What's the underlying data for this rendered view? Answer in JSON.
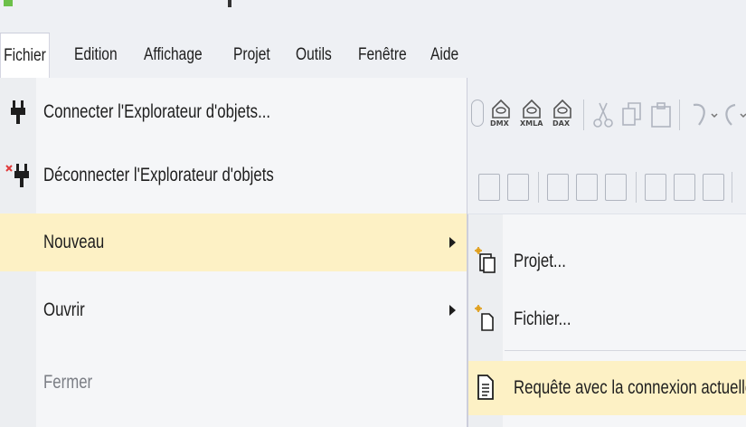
{
  "menubar": {
    "items": [
      {
        "label": "Fichier"
      },
      {
        "label": "Edition"
      },
      {
        "label": "Affichage"
      },
      {
        "label": "Projet"
      },
      {
        "label": "Outils"
      },
      {
        "label": "Fenêtre"
      },
      {
        "label": "Aide"
      }
    ]
  },
  "toolbar": {
    "labels": [
      "DMX",
      "XMLA",
      "DAX"
    ]
  },
  "file_menu": {
    "items": [
      {
        "label": "Connecter l'Explorateur d'objets...",
        "icon": "plug-icon"
      },
      {
        "label": "Déconnecter l'Explorateur d'objets",
        "icon": "plug-disconnect-icon"
      },
      {
        "label": "Nouveau",
        "has_submenu": true,
        "highlighted": true
      },
      {
        "label": "Ouvrir",
        "has_submenu": true
      },
      {
        "label": "Fermer",
        "disabled": true
      }
    ]
  },
  "new_submenu": {
    "items": [
      {
        "label": "Projet...",
        "icon": "new-project-icon"
      },
      {
        "label": "Fichier...",
        "icon": "new-file-icon"
      },
      {
        "label": "Requête avec la connexion actuelle",
        "icon": "query-document-icon",
        "highlighted": true
      }
    ]
  },
  "colors": {
    "highlight": "#fdf1c5",
    "menu_background": "#f5f6f8",
    "chrome_background": "#eef0f4"
  }
}
